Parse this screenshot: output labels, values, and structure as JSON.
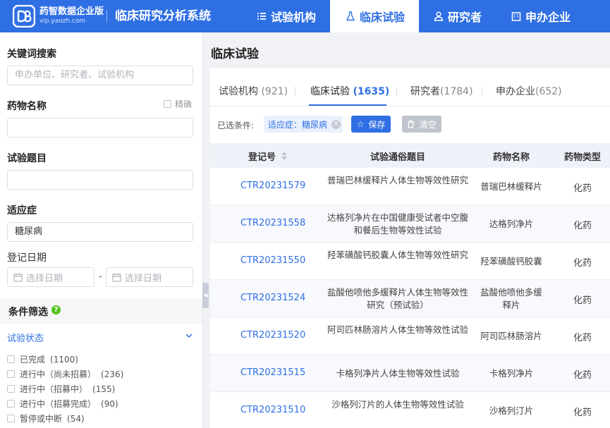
{
  "header": {
    "brand": "药智数据企业版",
    "brand_sub": "vip.yaozh.com",
    "system_title": "临床研究分析系统",
    "nav": [
      {
        "label": "试验机构",
        "icon": "list-icon",
        "active": false
      },
      {
        "label": "临床试验",
        "icon": "flask-icon",
        "active": true
      },
      {
        "label": "研究者",
        "icon": "person-icon",
        "active": false
      },
      {
        "label": "申办企业",
        "icon": "building-icon",
        "active": false
      }
    ]
  },
  "sidebar": {
    "keyword": {
      "label": "关键词搜索",
      "placeholder": "申办单位、研究者、试验机构"
    },
    "drug": {
      "label": "药物名称",
      "precise_label": "精确",
      "value": ""
    },
    "trial_title": {
      "label": "试验题目",
      "value": ""
    },
    "indication": {
      "label": "适应症",
      "value": "糖尿病"
    },
    "reg_date": {
      "label": "登记日期",
      "start_placeholder": "选择日期",
      "end_placeholder": "选择日期",
      "separator": "-"
    },
    "filter_title": "条件筛选",
    "status": {
      "label": "试验状态",
      "options": [
        {
          "label": "已完成",
          "count": "(1100)"
        },
        {
          "label": "进行中（尚未招募）",
          "count": "(236)"
        },
        {
          "label": "进行中（招募中）",
          "count": "(155)"
        },
        {
          "label": "进行中（招募完成）",
          "count": "(90)"
        },
        {
          "label": "暂停或中断",
          "count": "(54)"
        }
      ]
    }
  },
  "main": {
    "title": "临床试验",
    "tabs": [
      {
        "label": "试验机构",
        "count": "(921)"
      },
      {
        "label": "临床试验",
        "count": "(1635)"
      },
      {
        "label": "研究者",
        "count": "(1784)"
      },
      {
        "label": "申办企业",
        "count": "(652)"
      }
    ],
    "conditions_label": "已选条件:",
    "condition_tag": "适应症：糖尿病",
    "save_label": "保存",
    "clear_label": "清空",
    "table": {
      "headers": [
        "登记号",
        "试验通俗题目",
        "药物名称",
        "药物类型"
      ],
      "rows": [
        {
          "id": "CTR20231579",
          "title": "普瑞巴林缓释片人体生物等效性研究",
          "drug": "普瑞巴林缓释片",
          "type": "化药"
        },
        {
          "id": "CTR20231558",
          "title": "达格列净片在中国健康受试者中空腹和餐后生物等效性试验",
          "drug": "达格列净片",
          "type": "化药"
        },
        {
          "id": "CTR20231550",
          "title": "羟苯磺酸钙胶囊人体生物等效性研究",
          "drug": "羟苯磺酸钙胶囊",
          "type": "化药"
        },
        {
          "id": "CTR20231524",
          "title": "盐酸他喷他多缓释片人体生物等效性研究（预试验）",
          "drug": "盐酸他喷他多缓释片",
          "type": "化药"
        },
        {
          "id": "CTR20231520",
          "title": "阿司匹林肠溶片人体生物等效性试验",
          "drug": "阿司匹林肠溶片",
          "type": "化药"
        },
        {
          "id": "CTR20231515",
          "title": "卡格列净片人体生物等效性试验",
          "drug": "卡格列净片",
          "type": "化药"
        },
        {
          "id": "CTR20231510",
          "title": "沙格列汀片的人体生物等效性试验",
          "drug": "沙格列汀片",
          "type": "化药"
        }
      ]
    }
  },
  "colors": {
    "primary": "#2f6fe4",
    "help": "#52c41a"
  }
}
